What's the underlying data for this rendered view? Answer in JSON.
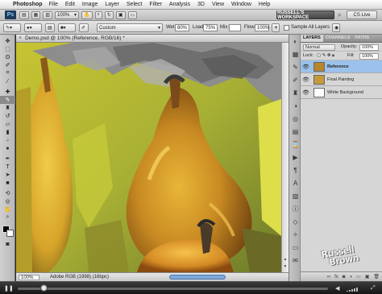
{
  "menubar": {
    "app_name": "Photoshop",
    "items": [
      "File",
      "Edit",
      "Image",
      "Layer",
      "Select",
      "Filter",
      "Analysis",
      "3D",
      "View",
      "Window",
      "Help"
    ]
  },
  "appbar": {
    "logo": "Ps",
    "zoom_value": "100%",
    "workspace_label": "RUSSELL'S WORKSPACE",
    "cs_live_label": "CS Live"
  },
  "options": {
    "preset_value": "Custom",
    "wet_label": "Wet:",
    "wet_value": "80%",
    "load_label": "Load:",
    "load_value": "75%",
    "mix_label": "Mix:",
    "flow_label": "Flow:",
    "flow_value": "100%",
    "sample_all_label": "Sample All Layers"
  },
  "document": {
    "title": "Demo.psd @ 100% (Reference, RGB/16) *",
    "status_zoom": "100%",
    "status_profile": "Adobe RGB (1998) (16bpc)"
  },
  "panel": {
    "tabs": [
      "LAYERS",
      "CHANNELS",
      "PATHS"
    ],
    "active_tab": "LAYERS",
    "blend_mode": "Normal",
    "opacity_label": "Opacity:",
    "opacity_value": "100%",
    "lock_label": "Lock:",
    "fill_label": "Fill:",
    "fill_value": "100%",
    "layers": [
      {
        "name": "Reference",
        "selected": true,
        "visible": true,
        "thumb_color": "#b8862a"
      },
      {
        "name": "Final Painting",
        "selected": false,
        "visible": true,
        "thumb_color": "#c49a3a"
      },
      {
        "name": "White Background",
        "selected": false,
        "visible": true,
        "thumb_color": "#ffffff"
      }
    ]
  },
  "watermark": {
    "line1": "Russell",
    "line2": "Brown"
  },
  "colors": {
    "accent_selected_layer": "#9cc1ea",
    "workspace_button": "#555555"
  }
}
